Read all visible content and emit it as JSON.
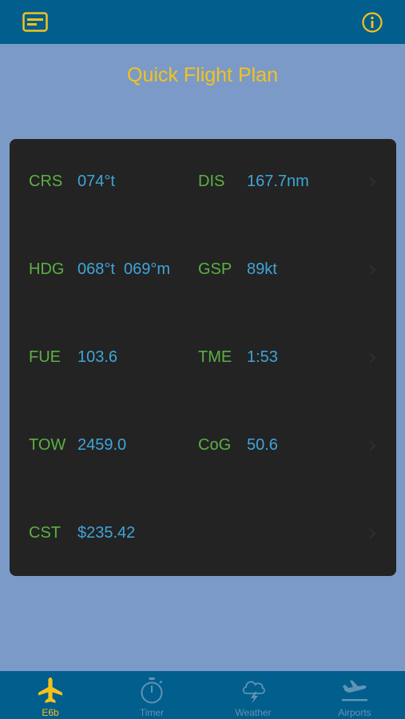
{
  "header": {
    "left_icon": "tablet-card-icon",
    "right_icon": "info-icon",
    "accent": "#f4c21c",
    "bar_color": "#025e8c"
  },
  "title": "Quick Flight Plan",
  "rows": [
    {
      "l1": "CRS",
      "v1": "074°t",
      "l2": "DIS",
      "v2": "167.7nm"
    },
    {
      "l1": "HDG",
      "v1": "068°t  069°m",
      "l2": "GSP",
      "v2": "89kt"
    },
    {
      "l1": "FUE",
      "v1": "103.6",
      "l2": "TME",
      "v2": "1:53"
    },
    {
      "l1": "TOW",
      "v1": "2459.0",
      "l2": "CoG",
      "v2": "50.6"
    },
    {
      "l1": "CST",
      "v1": "$235.42",
      "l2": "",
      "v2": ""
    }
  ],
  "tabs": [
    {
      "label": "E6b",
      "icon": "airplane-icon",
      "active": true
    },
    {
      "label": "Timer",
      "icon": "stopwatch-icon",
      "active": false
    },
    {
      "label": "Weather",
      "icon": "storm-cloud-icon",
      "active": false
    },
    {
      "label": "Airports",
      "icon": "departure-icon",
      "active": false
    }
  ]
}
